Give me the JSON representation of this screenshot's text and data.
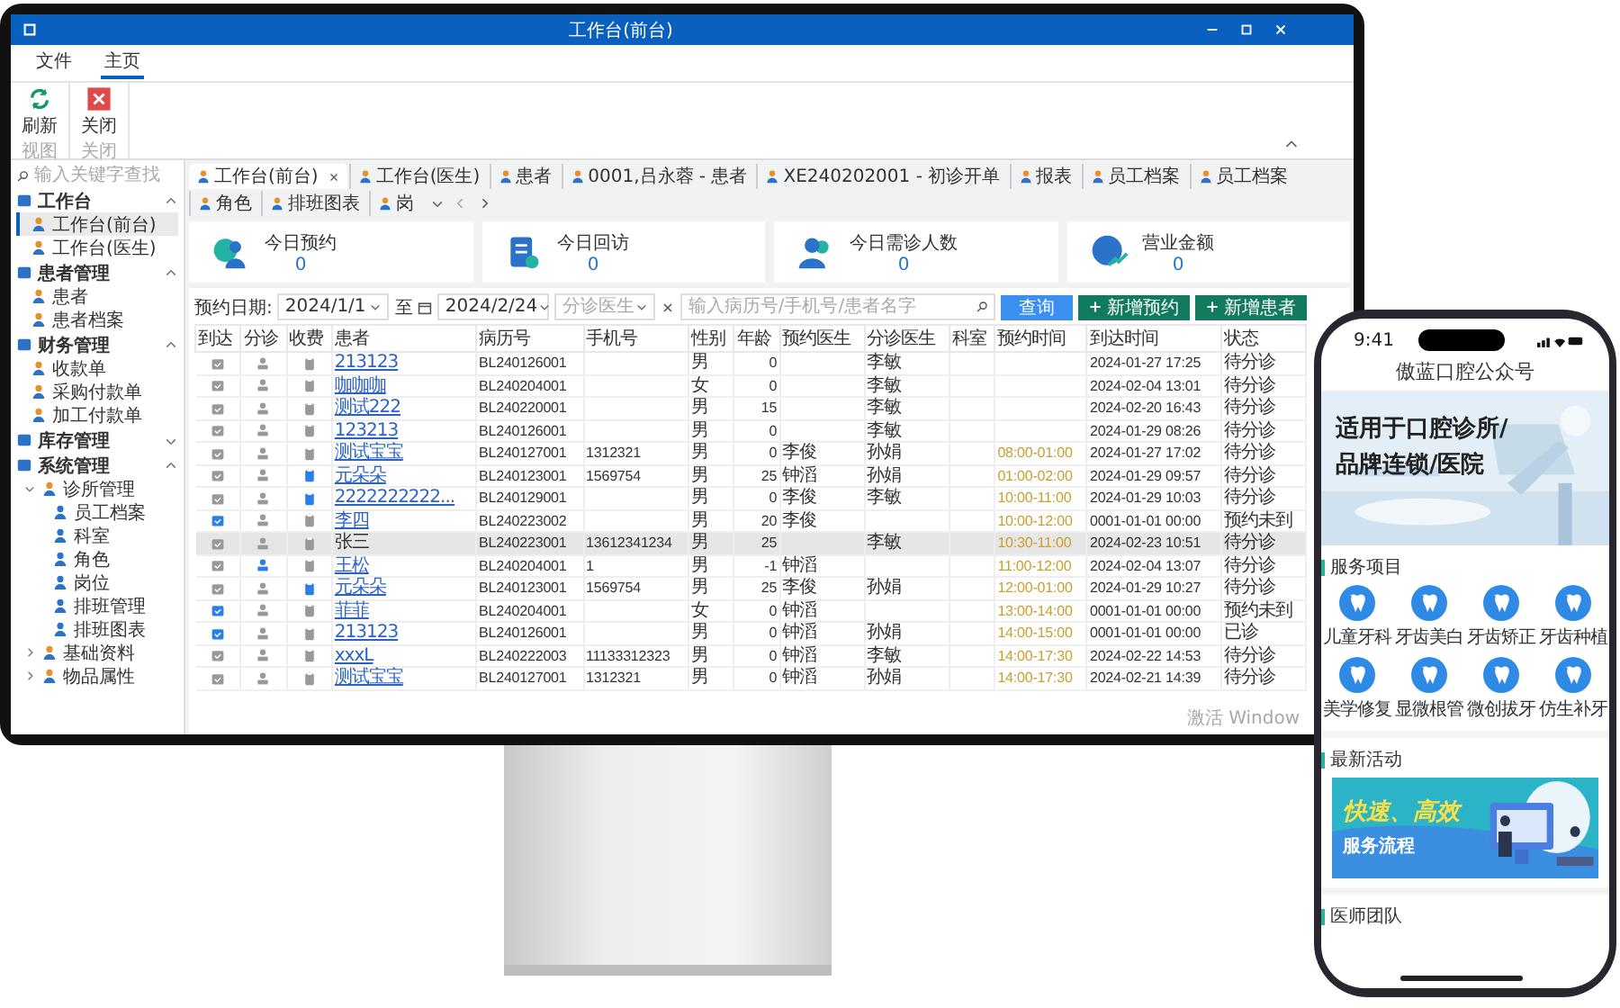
{
  "window": {
    "title": "工作台(前台)"
  },
  "menu": [
    {
      "label": "文件",
      "selected": false
    },
    {
      "label": "主页",
      "selected": true
    }
  ],
  "ribbon": {
    "groups": [
      {
        "label": "视图",
        "buttons": [
          {
            "kind": "refresh",
            "label": "刷新"
          }
        ]
      },
      {
        "label": "关闭",
        "buttons": [
          {
            "kind": "close",
            "label": "关闭"
          }
        ]
      }
    ]
  },
  "sidebar": {
    "search_placeholder": "输入关键字查找",
    "sections": [
      {
        "label": "工作台",
        "expanded": true,
        "children": [
          {
            "label": "工作台(前台)",
            "selected": true
          },
          {
            "label": "工作台(医生)",
            "selected": false
          }
        ]
      },
      {
        "label": "患者管理",
        "expanded": true,
        "children": [
          {
            "label": "患者",
            "selected": false
          },
          {
            "label": "患者档案",
            "selected": false
          }
        ]
      },
      {
        "label": "财务管理",
        "expanded": true,
        "children": [
          {
            "label": "收款单",
            "selected": false
          },
          {
            "label": "采购付款单",
            "selected": false
          },
          {
            "label": "加工付款单",
            "selected": false
          }
        ]
      },
      {
        "label": "库存管理",
        "expanded": false
      },
      {
        "label": "系统管理",
        "expanded": true,
        "children": [
          {
            "label": "诊所管理",
            "selected": false,
            "expanded": true,
            "children": [
              {
                "label": "员工档案",
                "selected": false
              },
              {
                "label": "科室",
                "selected": false
              },
              {
                "label": "角色",
                "selected": false
              },
              {
                "label": "岗位",
                "selected": false
              },
              {
                "label": "排班管理",
                "selected": false
              },
              {
                "label": "排班图表",
                "selected": false
              }
            ]
          },
          {
            "label": "基础资料",
            "selected": false,
            "expanded": false
          },
          {
            "label": "物品属性",
            "selected": false,
            "expanded": false
          }
        ]
      }
    ]
  },
  "tabs": [
    {
      "label": "工作台(前台)",
      "selected": true,
      "closable": true
    },
    {
      "label": "工作台(医生)",
      "selected": false,
      "closable": false
    },
    {
      "label": "患者",
      "selected": false,
      "closable": false
    },
    {
      "label": "0001,吕永蓉 - 患者",
      "selected": false,
      "closable": false
    },
    {
      "label": "XE240202001 - 初诊开单",
      "selected": false,
      "closable": false
    },
    {
      "label": "报表",
      "selected": false,
      "closable": false
    },
    {
      "label": "员工档案",
      "selected": false,
      "closable": false
    },
    {
      "label": "员工档案",
      "selected": false,
      "closable": false
    },
    {
      "label": "角色",
      "selected": false,
      "closable": false
    },
    {
      "label": "排班图表",
      "selected": false,
      "closable": false
    },
    {
      "label": "岗",
      "selected": false,
      "closable": false
    }
  ],
  "stats": [
    {
      "kind": "appointment",
      "label": "今日预约",
      "value": "0"
    },
    {
      "kind": "visit",
      "label": "今日回访",
      "value": "0"
    },
    {
      "kind": "patients",
      "label": "今日需诊人数",
      "value": "0"
    },
    {
      "kind": "revenue",
      "label": "营业金额",
      "value": "0"
    }
  ],
  "filter": {
    "date_label": "预约日期:",
    "date_from": "2024/1/1",
    "to_label": "至",
    "date_to": "2024/2/24",
    "doctor_placeholder": "分诊医生",
    "search_placeholder": "输入病历号/手机号/患者名字",
    "buttons": [
      {
        "kind": "query",
        "label": "查询"
      },
      {
        "kind": "add",
        "label": "新增预约"
      },
      {
        "kind": "add",
        "label": "新增患者"
      }
    ]
  },
  "table": {
    "columns": [
      "到达",
      "分诊",
      "收费",
      "患者",
      "病历号",
      "手机号",
      "性别",
      "年龄",
      "预约医生",
      "分诊医生",
      "科室",
      "预约时间",
      "到达时间",
      "状态"
    ],
    "rows": [
      {
        "arrived": false,
        "triaged": false,
        "charged": false,
        "selected": false,
        "patient": "213123",
        "record": "BL240126001",
        "sex": "男",
        "age": "0",
        "triage_doctor": "李敏",
        "arrival": "2024-01-27 17:25",
        "status": "待分诊"
      },
      {
        "arrived": false,
        "triaged": false,
        "charged": false,
        "selected": false,
        "patient": "咖咖咖",
        "record": "BL240204001",
        "sex": "女",
        "age": "0",
        "triage_doctor": "李敏",
        "arrival": "2024-02-04 13:01",
        "status": "待分诊"
      },
      {
        "arrived": false,
        "triaged": false,
        "charged": false,
        "selected": false,
        "patient": "测试222",
        "record": "BL240220001",
        "sex": "男",
        "age": "15",
        "triage_doctor": "李敏",
        "arrival": "2024-02-20 16:43",
        "status": "待分诊"
      },
      {
        "arrived": false,
        "triaged": false,
        "charged": false,
        "selected": false,
        "patient": "123213",
        "record": "BL240126001",
        "sex": "男",
        "age": "0",
        "triage_doctor": "李敏",
        "arrival": "2024-01-29 08:26",
        "status": "待分诊"
      },
      {
        "arrived": false,
        "triaged": false,
        "charged": false,
        "selected": false,
        "patient": "测试宝宝",
        "record": "BL240127001",
        "phone": "1312321",
        "sex": "男",
        "age": "0",
        "appt_doctor": "李俊",
        "triage_doctor": "孙娟",
        "appt_time": "08:00-01:00",
        "arrival": "2024-01-27 17:02",
        "status": "待分诊"
      },
      {
        "arrived": false,
        "triaged": false,
        "charged": true,
        "selected": false,
        "patient": "元朵朵",
        "record": "BL240123001",
        "phone": "1569754",
        "sex": "男",
        "age": "25",
        "appt_doctor": "钟滔",
        "triage_doctor": "孙娟",
        "appt_time": "01:00-02:00",
        "arrival": "2024-01-29 09:57",
        "status": "待分诊"
      },
      {
        "arrived": false,
        "triaged": false,
        "charged": true,
        "selected": false,
        "patient": "2222222222...",
        "record": "BL240129001",
        "sex": "男",
        "age": "0",
        "appt_doctor": "李俊",
        "triage_doctor": "李敏",
        "appt_time": "10:00-11:00",
        "arrival": "2024-01-29 10:03",
        "status": "待分诊"
      },
      {
        "arrived": true,
        "triaged": false,
        "charged": false,
        "selected": false,
        "patient": "李四",
        "record": "BL240223002",
        "sex": "男",
        "age": "20",
        "appt_doctor": "李俊",
        "appt_time": "10:00-12:00",
        "arrival": "0001-01-01 00:00",
        "status": "预约未到"
      },
      {
        "arrived": false,
        "triaged": false,
        "charged": false,
        "selected": true,
        "patient": "张三",
        "record": "BL240223001",
        "phone": "13612341234",
        "sex": "男",
        "age": "25",
        "triage_doctor": "李敏",
        "appt_time": "10:30-11:00",
        "arrival": "2024-02-23 10:51",
        "status": "待分诊"
      },
      {
        "arrived": false,
        "triaged": true,
        "charged": false,
        "selected": false,
        "patient": "王松",
        "record": "BL240204001",
        "phone": "1",
        "sex": "男",
        "age": "-1",
        "appt_doctor": "钟滔",
        "appt_time": "11:00-12:00",
        "arrival": "2024-02-04 13:07",
        "status": "待分诊"
      },
      {
        "arrived": false,
        "triaged": false,
        "charged": true,
        "selected": false,
        "patient": "元朵朵",
        "record": "BL240123001",
        "phone": "1569754",
        "sex": "男",
        "age": "25",
        "appt_doctor": "李俊",
        "triage_doctor": "孙娟",
        "appt_time": "12:00-01:00",
        "arrival": "2024-01-29 10:27",
        "status": "待分诊"
      },
      {
        "arrived": true,
        "triaged": false,
        "charged": false,
        "selected": false,
        "patient": "菲菲",
        "record": "BL240204001",
        "sex": "女",
        "age": "0",
        "appt_doctor": "钟滔",
        "appt_time": "13:00-14:00",
        "arrival": "0001-01-01 00:00",
        "status": "预约未到"
      },
      {
        "arrived": true,
        "triaged": false,
        "charged": false,
        "selected": false,
        "patient": "213123",
        "record": "BL240126001",
        "sex": "男",
        "age": "0",
        "appt_doctor": "钟滔",
        "triage_doctor": "孙娟",
        "appt_time": "14:00-15:00",
        "arrival": "0001-01-01 00:00",
        "status": "已诊"
      },
      {
        "arrived": false,
        "triaged": false,
        "charged": false,
        "selected": false,
        "patient": "xxxL",
        "record": "BL240222003",
        "phone": "11133312323",
        "sex": "男",
        "age": "0",
        "appt_doctor": "钟滔",
        "triage_doctor": "李敏",
        "appt_time": "14:00-17:30",
        "arrival": "2024-02-22 14:53",
        "status": "待分诊"
      },
      {
        "arrived": false,
        "triaged": false,
        "charged": false,
        "selected": false,
        "patient": "测试宝宝",
        "record": "BL240127001",
        "phone": "1312321",
        "sex": "男",
        "age": "0",
        "appt_doctor": "钟滔",
        "triage_doctor": "孙娟",
        "appt_time": "14:00-17:30",
        "arrival": "2024-02-21 14:39",
        "status": "待分诊"
      }
    ]
  },
  "activation_notice": "激活 Window",
  "phone": {
    "time": "9:41",
    "title": "傲蓝口腔公众号",
    "banner_lines": [
      "适用于口腔诊所/",
      "品牌连锁/医院"
    ],
    "services_title": "服务项目",
    "services": [
      "儿童牙科",
      "牙齿美白",
      "牙齿矫正",
      "牙齿种植",
      "美学修复",
      "显微根管",
      "微创拔牙",
      "仿生补牙"
    ],
    "activity_title": "最新活动",
    "promo": {
      "headline": "快速、高效",
      "subline": "服务流程"
    },
    "team_title": "医师团队"
  }
}
